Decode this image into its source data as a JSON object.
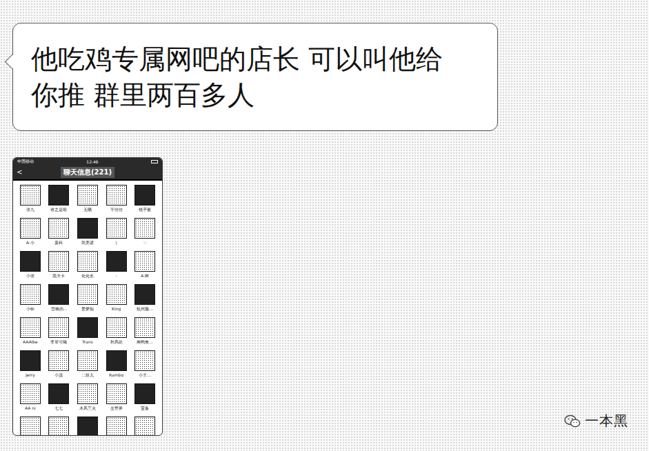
{
  "message": {
    "text": "他吃鸡专属网吧的店长 可以叫他给你推 群里两百多人"
  },
  "screenshot": {
    "status_bar": {
      "carrier": "中国移动",
      "time": "12:46"
    },
    "back": "<",
    "title": "聊天信息(221)",
    "members": [
      {
        "name": "张九"
      },
      {
        "name": "谁之是啦"
      },
      {
        "name": "无晒"
      },
      {
        "name": "平佳佳"
      },
      {
        "name": "桃子酱"
      },
      {
        "name": "A-小"
      },
      {
        "name": "黄科"
      },
      {
        "name": "凯美诺"
      },
      {
        "name": "J"
      },
      {
        "name": "♡"
      },
      {
        "name": "小张"
      },
      {
        "name": "黑大卡"
      },
      {
        "name": "化化名"
      },
      {
        "name": "-"
      },
      {
        "name": "A-林"
      },
      {
        "name": "小Bi"
      },
      {
        "name": "雷格的..."
      },
      {
        "name": "爱梦如"
      },
      {
        "name": "King"
      },
      {
        "name": "杭州服..."
      },
      {
        "name": "AAAlbe"
      },
      {
        "name": "李哥可喝"
      },
      {
        "name": "Trans"
      },
      {
        "name": "秋风吹"
      },
      {
        "name": "烤鸭食..."
      },
      {
        "name": "Jerry"
      },
      {
        "name": "小茂"
      },
      {
        "name": "二娃儿"
      },
      {
        "name": "Rambo"
      },
      {
        "name": "小王..."
      },
      {
        "name": "AA ni"
      },
      {
        "name": "七七"
      },
      {
        "name": "木风三火"
      },
      {
        "name": "全世界"
      },
      {
        "name": "宝备"
      },
      {
        "name": ""
      },
      {
        "name": ""
      },
      {
        "name": ""
      },
      {
        "name": ""
      },
      {
        "name": ""
      }
    ]
  },
  "watermark": {
    "text": "一本黑"
  }
}
